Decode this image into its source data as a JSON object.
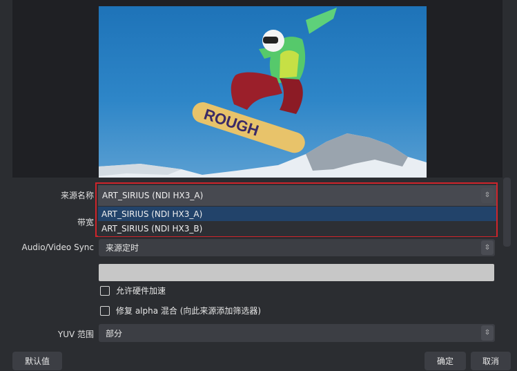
{
  "preview": {
    "image_description_icon": "snowboarder-photo",
    "board_text": "ROUGH"
  },
  "form": {
    "source_name_label": "来源名称",
    "source_name_value": "ART_SIRIUS (NDI HX3_A)",
    "source_options": [
      "ART_SIRIUS (NDI HX3_A)",
      "ART_SIRIUS (NDI HX3_B)"
    ],
    "bandwidth_label": "带宽",
    "av_sync_label": "Audio/Video Sync",
    "av_sync_value": "来源定时",
    "hw_accel_label": "允许硬件加速",
    "alpha_fix_label": "修复 alpha 混合 (向此来源添加筛选器)",
    "yuv_range_label": "YUV 范围",
    "yuv_range_value": "部分"
  },
  "buttons": {
    "defaults": "默认值",
    "ok": "确定",
    "cancel": "取消"
  },
  "colors": {
    "highlight": "#d0242b",
    "selected_item": "#22436a"
  }
}
